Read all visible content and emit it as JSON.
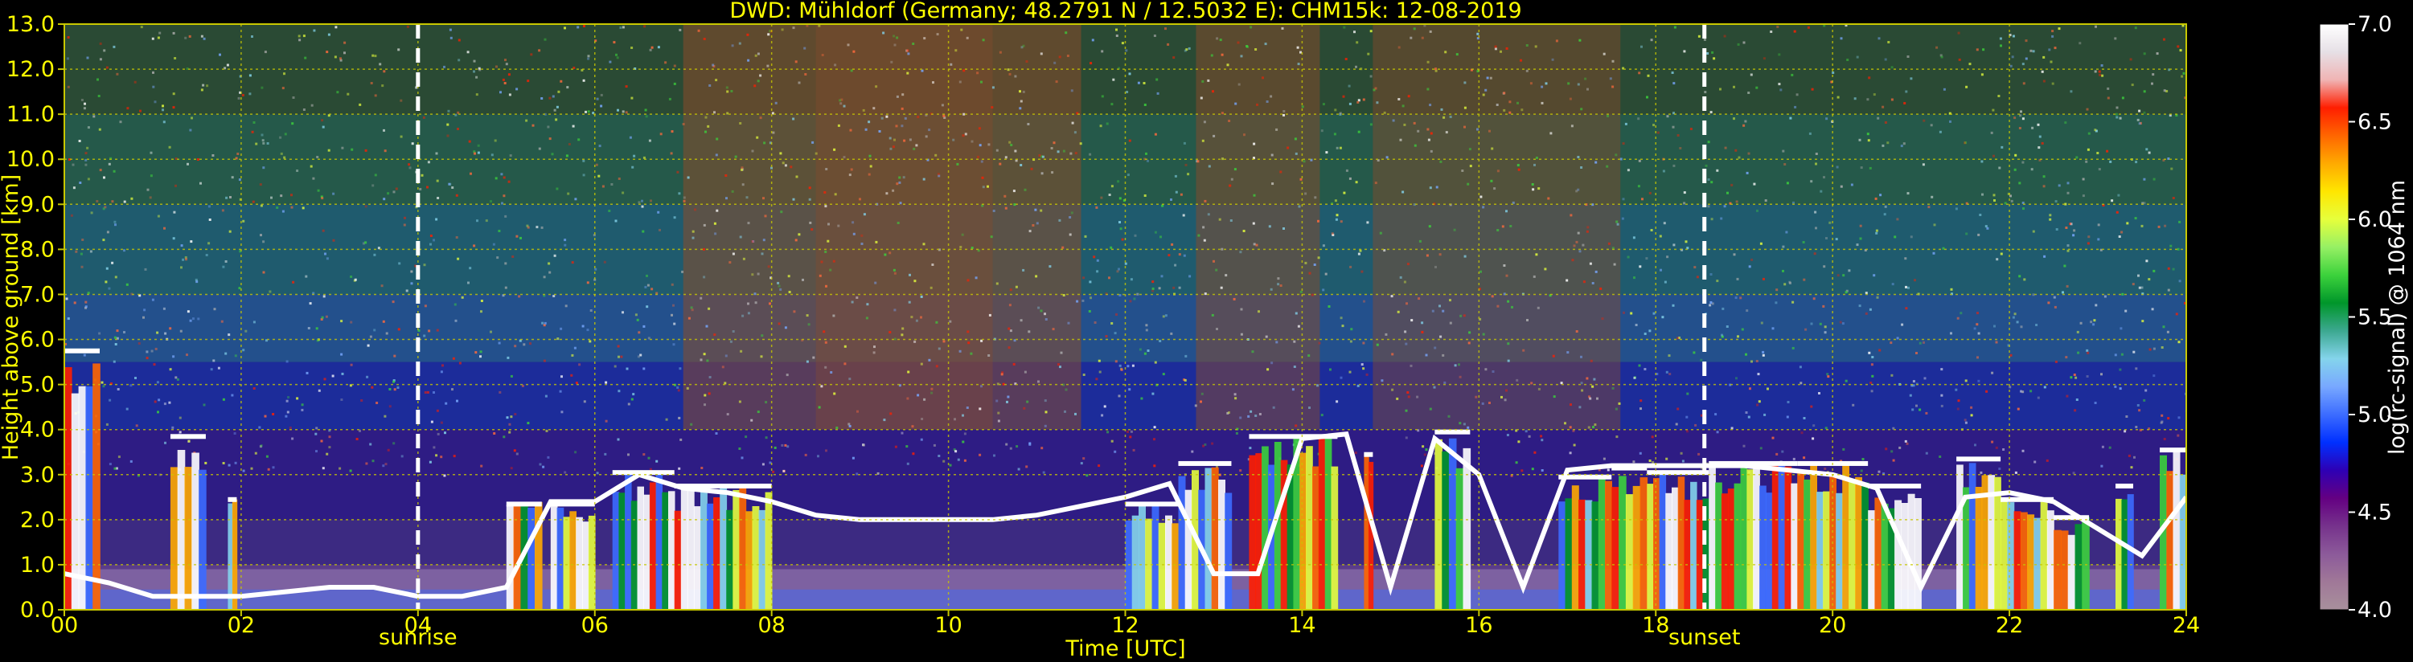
{
  "chart_data": {
    "type": "heatmap",
    "title": "DWD: Mühldorf (Germany; 48.2791 N / 12.5032 E):    CHM15k: 12-08-2019",
    "xlabel": "Time [UTC]",
    "ylabel": "Height above ground [km]",
    "xlim": [
      0,
      24
    ],
    "ylim": [
      0,
      13
    ],
    "x_ticks": [
      "00",
      "02",
      "04",
      "06",
      "08",
      "10",
      "12",
      "14",
      "16",
      "18",
      "20",
      "22",
      "24"
    ],
    "y_ticks": [
      "0.0",
      "1.0",
      "2.0",
      "3.0",
      "4.0",
      "5.0",
      "6.0",
      "7.0",
      "8.0",
      "9.0",
      "10.0",
      "11.0",
      "12.0",
      "13.0"
    ],
    "grid": true,
    "events": [
      {
        "label": "sunrise",
        "x": 4.0
      },
      {
        "label": "sunset",
        "x": 18.55
      }
    ],
    "colorbar": {
      "label": "log(rc-signal) @ 1064 nm",
      "range": [
        4.0,
        7.0
      ],
      "ticks": [
        "4.0",
        "4.5",
        "5.0",
        "5.5",
        "6.0",
        "6.5",
        "7.0"
      ]
    },
    "colors": {
      "text": "#ffff00",
      "grid": "#c8c800",
      "background": "#000000",
      "colorbar_text": "#ffffff",
      "colorbar_stops": [
        "#a8909c",
        "#a07898",
        "#8c5a9a",
        "#76328c",
        "#640082",
        "#2e00b4",
        "#0030ff",
        "#3c6cff",
        "#78a8ff",
        "#84d4ec",
        "#3ca890",
        "#00962a",
        "#3cd23c",
        "#96f064",
        "#e6ff3c",
        "#ffe600",
        "#ffaa00",
        "#ff6600",
        "#ff1e00",
        "#f0b4b4",
        "#e6e0e6",
        "#ffffff"
      ]
    },
    "series": [
      {
        "name": "boundary_layer_top_km",
        "x": [
          0,
          0.5,
          1,
          1.5,
          2,
          2.5,
          3,
          3.5,
          4,
          4.5,
          5,
          5.5,
          6,
          6.5,
          7,
          7.5,
          8,
          8.5,
          9,
          9.5,
          10,
          10.5,
          11,
          11.5,
          12,
          12.5,
          13,
          13.5,
          14,
          14.5,
          15,
          15.5,
          16,
          16.5,
          17,
          17.5,
          18,
          18.5,
          19,
          19.5,
          20,
          20.5,
          21,
          21.5,
          22,
          22.5,
          23,
          23.5,
          24
        ],
        "y": [
          0.8,
          0.6,
          0.3,
          0.3,
          0.3,
          0.4,
          0.5,
          0.5,
          0.3,
          0.3,
          0.5,
          2.4,
          2.4,
          3.0,
          2.7,
          2.6,
          2.4,
          2.1,
          2.0,
          2.0,
          2.0,
          2.0,
          2.1,
          2.3,
          2.5,
          2.8,
          0.8,
          0.8,
          3.8,
          3.9,
          0.5,
          3.8,
          3.0,
          0.5,
          3.1,
          3.2,
          3.2,
          3.2,
          3.2,
          3.1,
          3.0,
          2.7,
          0.5,
          2.5,
          2.6,
          2.4,
          1.8,
          1.2,
          2.5
        ]
      }
    ]
  }
}
